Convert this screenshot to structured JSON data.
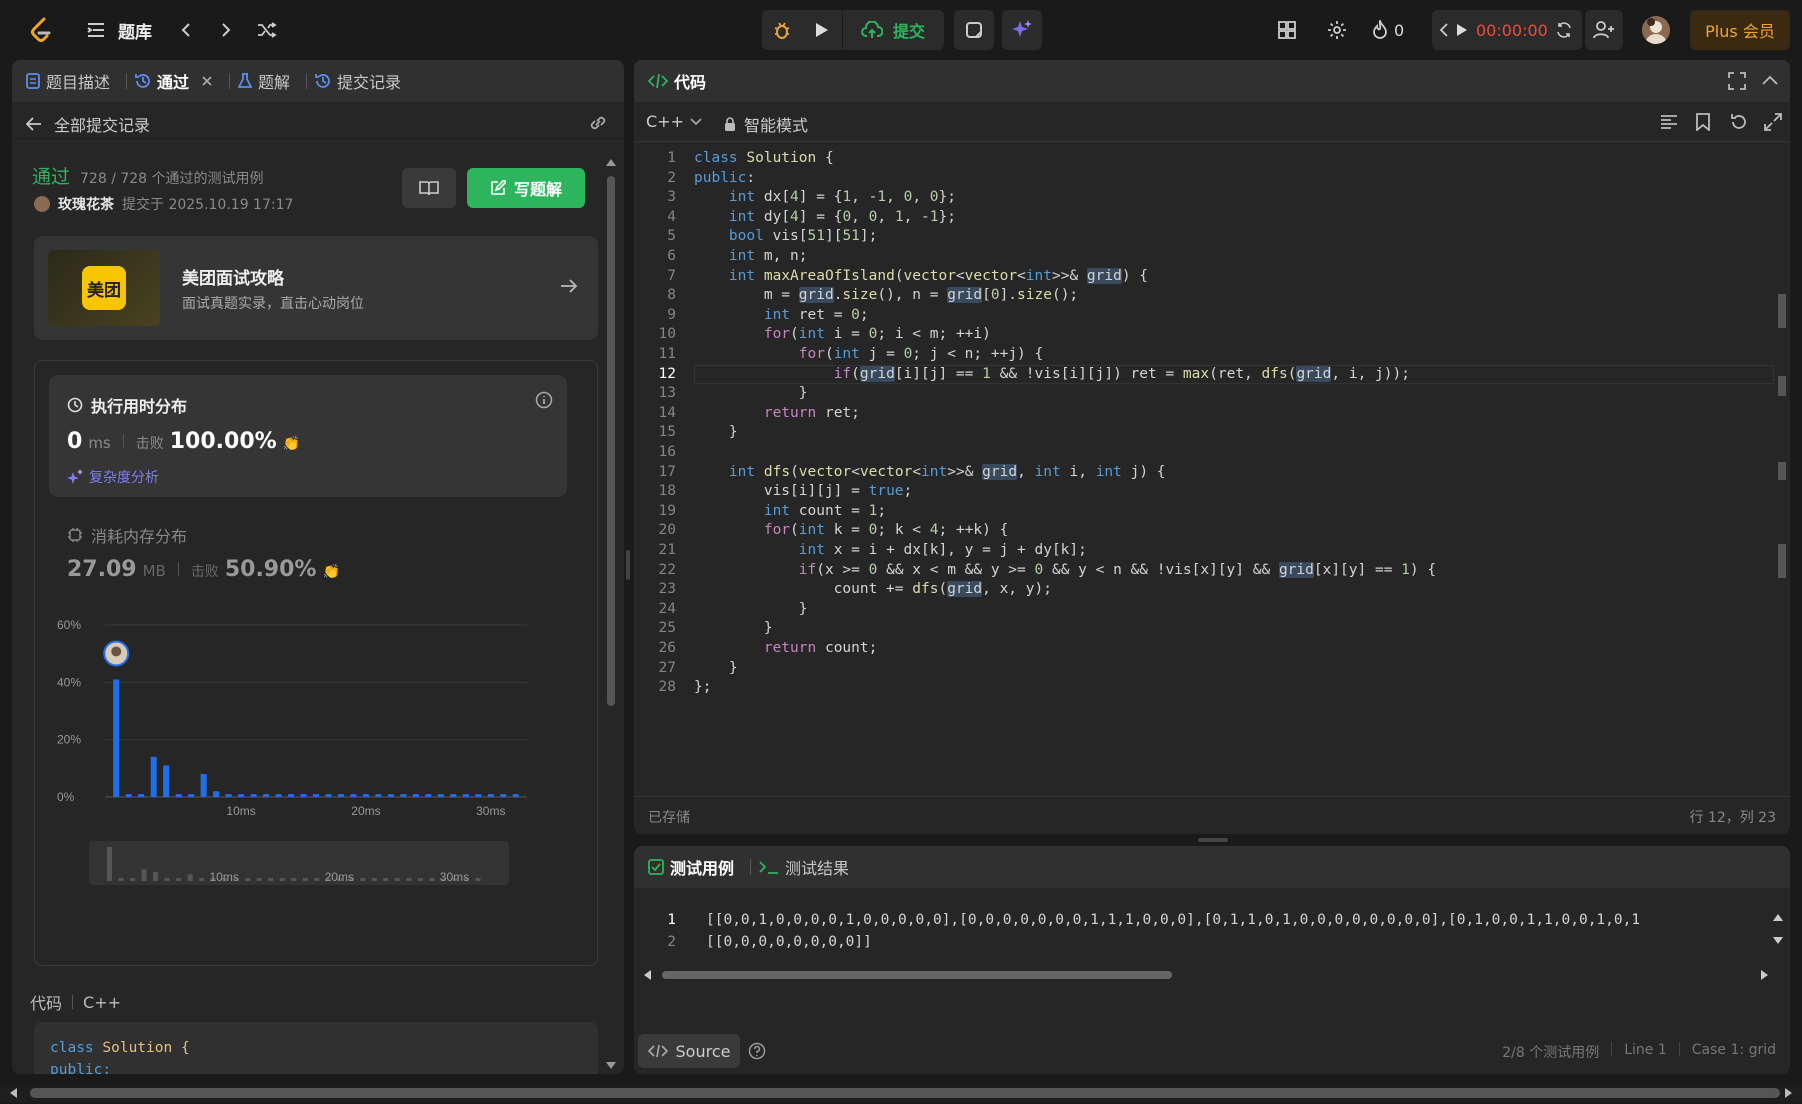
{
  "topbar": {
    "title": "题库",
    "submit_label": "提交",
    "streak": "0",
    "timer": "00:00:00",
    "plus_label": "Plus 会员"
  },
  "left": {
    "tabs": [
      {
        "label": "题目描述"
      },
      {
        "label": "通过"
      },
      {
        "label": "题解"
      },
      {
        "label": "提交记录"
      }
    ],
    "back_label": "全部提交记录",
    "status": "通过",
    "cases": "728 / 728 个通过的测试用例",
    "user": "玫瑰花茶",
    "submitted_at": "提交于 2025.10.19 17:17",
    "write_solution": "写题解",
    "ad": {
      "logo": "美团",
      "title": "美团面试攻略",
      "subtitle": "面试真题实录，直击心动岗位"
    },
    "runtime": {
      "title": "执行用时分布",
      "value": "0",
      "unit": "ms",
      "beats_label": "击败",
      "beats": "100.00%",
      "analysis": "复杂度分析"
    },
    "memory": {
      "title": "消耗内存分布",
      "value": "27.09",
      "unit": "MB",
      "beats_label": "击败",
      "beats": "50.90%"
    },
    "code_label": "代码",
    "code_lang": "C++",
    "code_preview": [
      "class Solution {",
      "public:"
    ]
  },
  "chart_data": {
    "type": "bar",
    "ylim": [
      0,
      60
    ],
    "yticks": [
      "60%",
      "40%",
      "20%",
      "0%"
    ],
    "xticks": [
      "10ms",
      "20ms",
      "30ms"
    ],
    "x_range": [
      0,
      32
    ],
    "x": [
      0,
      1,
      2,
      3,
      4,
      5,
      6,
      7,
      8,
      9,
      10,
      11,
      12,
      13,
      14,
      15,
      16,
      17,
      18,
      19,
      20,
      21,
      22,
      23,
      24,
      25,
      26,
      27,
      28,
      29,
      30,
      31,
      32
    ],
    "values": [
      41,
      1,
      1,
      14,
      11,
      1,
      1,
      8,
      2,
      1,
      1,
      1,
      1,
      1,
      1,
      1,
      1,
      1,
      1,
      1,
      1,
      1,
      1,
      1,
      1,
      1,
      1,
      1,
      1,
      1,
      1,
      1,
      1
    ],
    "highlight_index": 0
  },
  "editor": {
    "title": "代码",
    "language": "C++",
    "mode": "智能模式",
    "lines": [
      "class Solution {",
      "public:",
      "    int dx[4] = {1, -1, 0, 0};",
      "    int dy[4] = {0, 0, 1, -1};",
      "    bool vis[51][51];",
      "    int m, n;",
      "    int maxAreaOfIsland(vector<vector<int>>& grid) {",
      "        m = grid.size(), n = grid[0].size();",
      "        int ret = 0;",
      "        for(int i = 0; i < m; ++i)",
      "            for(int j = 0; j < n; ++j) {",
      "                if(grid[i][j] == 1 && !vis[i][j]) ret = max(ret, dfs(grid, i, j));",
      "            }",
      "        return ret;",
      "    }",
      "",
      "    int dfs(vector<vector<int>>& grid, int i, int j) {",
      "        vis[i][j] = true;",
      "        int count = 1;",
      "        for(int k = 0; k < 4; ++k) {",
      "            int x = i + dx[k], y = j + dy[k];",
      "            if(x >= 0 && x < m && y >= 0 && y < n && !vis[x][y] && grid[x][y] == 1) {",
      "                count += dfs(grid, x, y);",
      "            }",
      "        }",
      "        return count;",
      "    }",
      "};"
    ],
    "active_line": 12,
    "saved": "已存储",
    "cursor": "行 12，列 23"
  },
  "testpanel": {
    "tab_cases": "测试用例",
    "tab_results": "测试结果",
    "lines": [
      "[[0,0,1,0,0,0,0,1,0,0,0,0,0],[0,0,0,0,0,0,0,1,1,1,0,0,0],[0,1,1,0,1,0,0,0,0,0,0,0,0],[0,1,0,0,1,1,0,0,1,0,1",
      "[[0,0,0,0,0,0,0,0]]"
    ],
    "source_label": "Source",
    "status": "2/8 个测试用例",
    "line_info": "Line 1",
    "case_info": "Case 1: grid"
  }
}
